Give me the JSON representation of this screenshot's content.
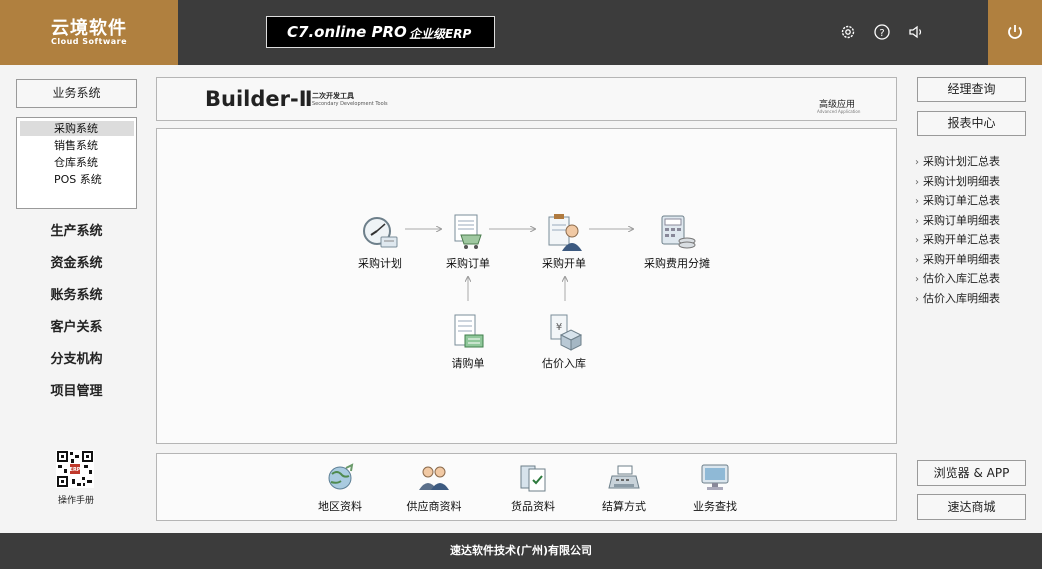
{
  "brand": {
    "name_cn": "云境软件",
    "name_en": "Cloud Software",
    "color": "#b0803f"
  },
  "product": {
    "name": "C7.online  PRO",
    "edition": "企业级ERP"
  },
  "top_icons": [
    "gear-icon",
    "help-icon",
    "sound-icon",
    "power-icon"
  ],
  "sidebar": {
    "business_system": "业务系统",
    "sub_items": [
      "采购系统",
      "销售系统",
      "仓库系统",
      "POS 系统"
    ],
    "nav_items": [
      "生产系统",
      "资金系统",
      "账务系统",
      "客户关系",
      "分支机构",
      "项目管理"
    ],
    "manual_label": "操作手册"
  },
  "builder": {
    "logo": "Builder-Ⅱ",
    "logo_cn": "二次开发工具",
    "logo_en": "Secondary Development Tools",
    "advanced_cn": "高级应用",
    "advanced_en": "Advanced Application"
  },
  "flow": {
    "purchase_plan": "采购计划",
    "purchase_order": "采购订单",
    "purchase_invoice": "采购开单",
    "expense_allocation": "采购费用分摊",
    "requisition": "请购单",
    "estimated_receipt": "估价入库"
  },
  "bottom": {
    "region": "地区资料",
    "supplier": "供应商资料",
    "goods": "货品资料",
    "settlement": "结算方式",
    "business_search": "业务查找"
  },
  "right": {
    "manager_query": "经理查询",
    "report_center": "报表中心",
    "reports": [
      "采购计划汇总表",
      "采购计划明细表",
      "采购订单汇总表",
      "采购订单明细表",
      "采购开单汇总表",
      "采购开单明细表",
      "估价入库汇总表",
      "估价入库明细表"
    ],
    "browser_app": "浏览器 & APP",
    "suda_mall": "速达商城"
  },
  "footer": "速达软件技术(广州)有限公司"
}
